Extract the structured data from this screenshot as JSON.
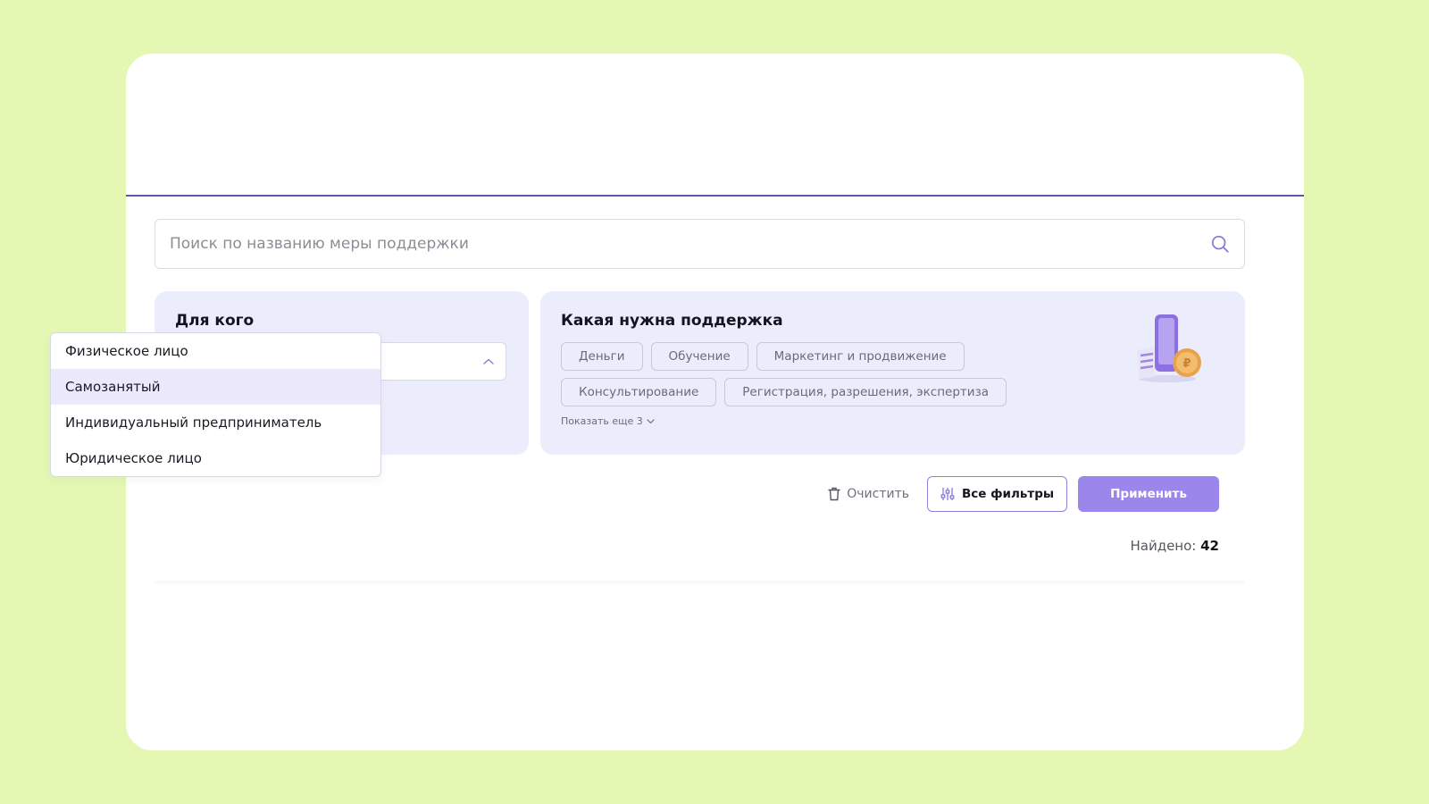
{
  "search": {
    "placeholder": "Поиск по названию меры поддержки"
  },
  "who": {
    "title": "Для кого",
    "selected_value": "",
    "options": [
      {
        "label": "Физическое лицо"
      },
      {
        "label": "Самозанятый"
      },
      {
        "label": "Индивидуальный предприниматель"
      },
      {
        "label": "Юридическое лицо"
      }
    ],
    "highlighted_option": "Самозанятый"
  },
  "support": {
    "title": "Какая нужна поддержка",
    "chips_row1": [
      "Деньги",
      "Обучение",
      "Маркетинг и продвижение"
    ],
    "chips_row2": [
      "Консультирование",
      "Регистрация, разрешения, экспертиза"
    ],
    "show_more": "Показать еще 3"
  },
  "actions": {
    "clear_label": "Очистить",
    "filters_label": "Все фильтры",
    "apply_label": "Применить"
  },
  "results": {
    "found_label": "Найдено:",
    "count": "42"
  },
  "colors": {
    "page_background": "#e4f8b4",
    "panel_background": "#ecedfc",
    "accent": "#9b87ec",
    "divider": "#5a57a8"
  },
  "icons": {
    "search": "search-icon",
    "chevron": "chevron-up-icon",
    "trash": "trash-icon",
    "filters": "sliders-icon",
    "illustration": "phone-receipt-coin-illustration"
  }
}
